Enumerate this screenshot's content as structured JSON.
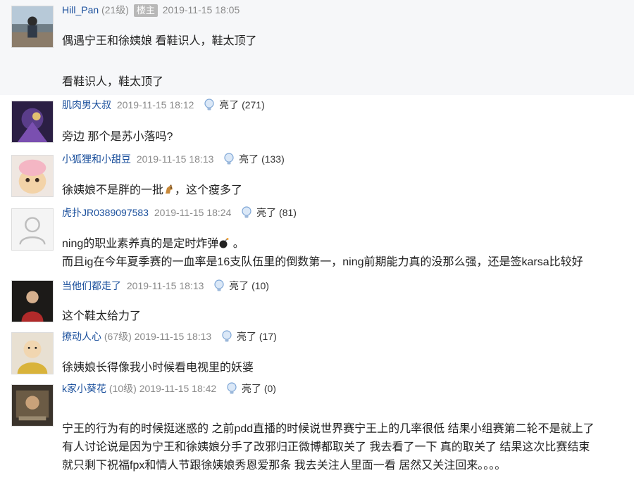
{
  "posts": [
    {
      "username": "Hill_Pan",
      "level": "(21级)",
      "badge": "楼主",
      "time": "2019-11-15 18:05",
      "lines": [
        "偶遇宁王和徐姨娘 看鞋识人，鞋太顶了",
        "看鞋识人，鞋太顶了"
      ]
    },
    {
      "username": "肌肉男大叔",
      "time": "2019-11-15 18:12",
      "light_label": "亮了",
      "light_count": "(271)",
      "lines": [
        "旁边 那个是苏小落吗?"
      ]
    },
    {
      "username": "小狐狸和小甜豆",
      "time": "2019-11-15 18:13",
      "light_label": "亮了",
      "light_count": "(133)",
      "lines": [
        "徐姨娘不是胖的一批",
        "，这个瘦多了"
      ]
    },
    {
      "username": "虎扑JR0389097583",
      "time": "2019-11-15 18:24",
      "light_label": "亮了",
      "light_count": "(81)",
      "lines": [
        "ning的职业素养真的是定时炸弹",
        "。",
        "而且ig在今年夏季赛的一血率是16支队伍里的倒数第一，ning前期能力真的没那么强，还是签karsa比较好"
      ]
    },
    {
      "username": "当他们都走了",
      "time": "2019-11-15 18:13",
      "light_label": "亮了",
      "light_count": "(10)",
      "lines": [
        "这个鞋太给力了"
      ]
    },
    {
      "username": "撩动人心",
      "level": "(67级)",
      "time": "2019-11-15 18:13",
      "light_label": "亮了",
      "light_count": "(17)",
      "lines": [
        "徐姨娘长得像我小时候看电视里的妖婆"
      ]
    },
    {
      "username": "k家小葵花",
      "level": "(10级)",
      "time": "2019-11-15 18:42",
      "light_label": "亮了",
      "light_count": "(0)",
      "lines": [
        "宁王的行为有的时候挺迷惑的 之前pdd直播的时候说世界赛宁王上的几率很低 结果小组赛第二轮不是就上了",
        "有人讨论说是因为宁王和徐姨娘分手了改邪归正微博都取关了 我去看了一下 真的取关了 结果这次比赛结束",
        "就只剩下祝福fpx和情人节跟徐姨娘秀恩爱那条 我去关注人里面一看 居然又关注回来。。。。"
      ]
    }
  ],
  "icons": {
    "light": "lightbulb-icon",
    "emoji_horse": "horse-emoji-icon",
    "emoji_bomb": "bomb-emoji-icon"
  },
  "colors": {
    "username": "#1a4f9c",
    "meta_gray": "#8a8a8a",
    "badge_bg": "#b8b8b8",
    "op_bg": "#f6f7f9"
  }
}
